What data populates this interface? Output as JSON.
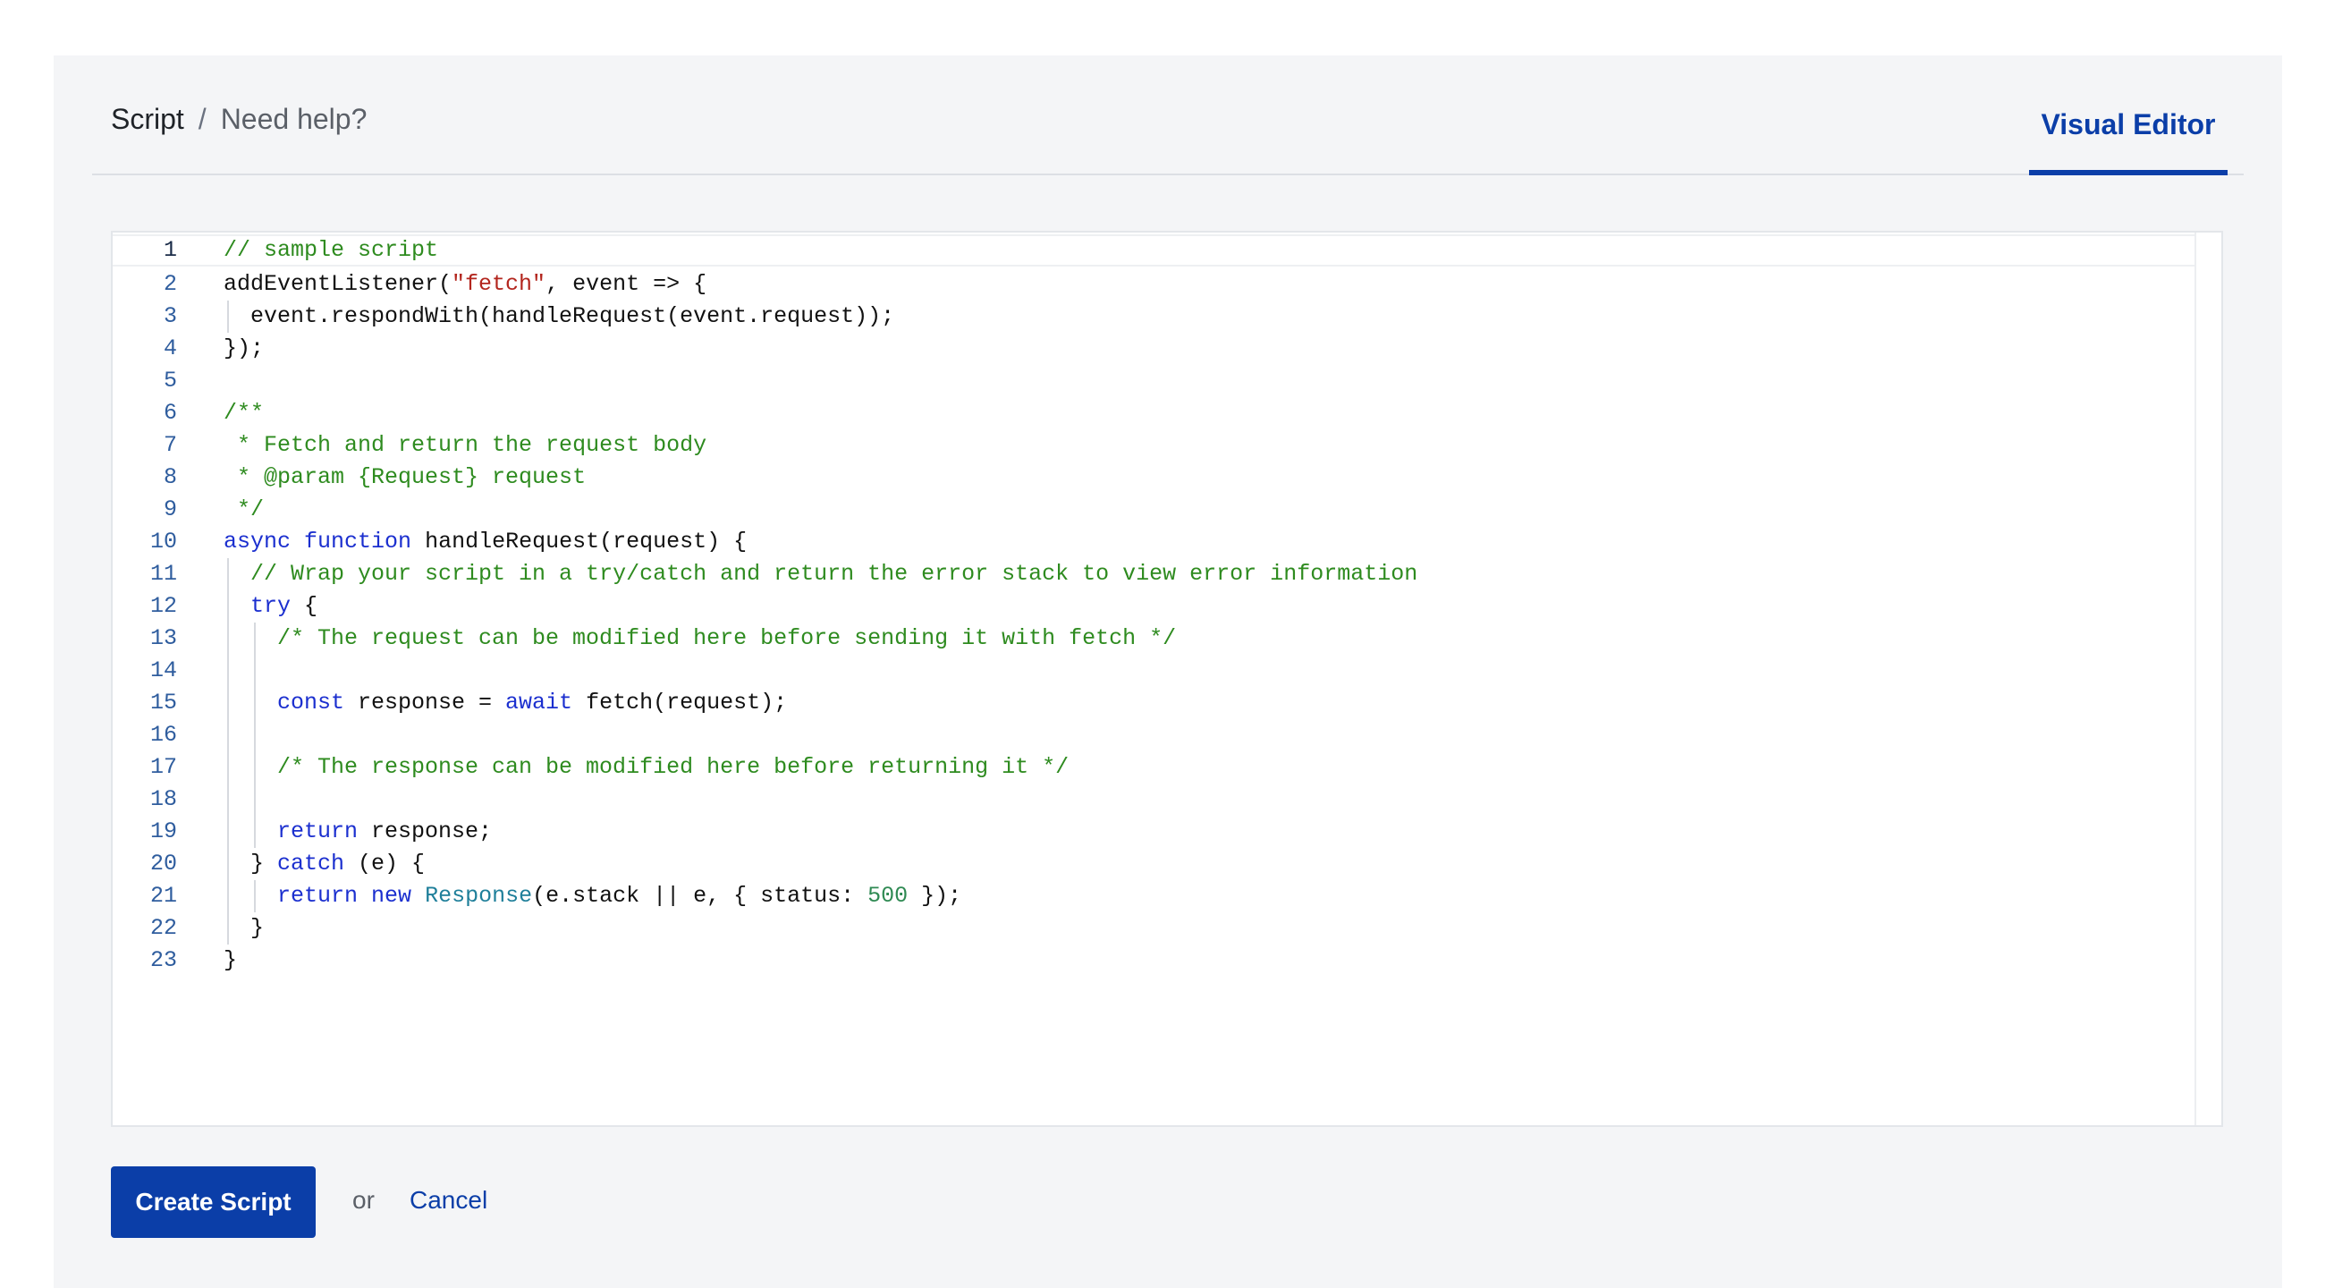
{
  "breadcrumb": {
    "current": "Script",
    "separator": "/",
    "help_link": "Need help?"
  },
  "tabs": {
    "visual_editor": "Visual Editor"
  },
  "editor": {
    "language": "javascript",
    "lines": [
      {
        "n": "1",
        "indent": 0,
        "tokens": [
          {
            "t": "// sample script",
            "c": "comment"
          }
        ]
      },
      {
        "n": "2",
        "indent": 0,
        "tokens": [
          {
            "t": "addEventListener(",
            "c": "plain"
          },
          {
            "t": "\"fetch\"",
            "c": "string"
          },
          {
            "t": ", event => {",
            "c": "plain"
          }
        ]
      },
      {
        "n": "3",
        "indent": 1,
        "tokens": [
          {
            "t": "event.respondWith(handleRequest(event.request));",
            "c": "plain"
          }
        ]
      },
      {
        "n": "4",
        "indent": 0,
        "tokens": [
          {
            "t": "});",
            "c": "plain"
          }
        ]
      },
      {
        "n": "5",
        "indent": 0,
        "tokens": []
      },
      {
        "n": "6",
        "indent": 0,
        "tokens": [
          {
            "t": "/**",
            "c": "comment"
          }
        ]
      },
      {
        "n": "7",
        "indent": 0,
        "tokens": [
          {
            "t": " * Fetch and return the request body",
            "c": "comment"
          }
        ]
      },
      {
        "n": "8",
        "indent": 0,
        "tokens": [
          {
            "t": " * @param {Request} request",
            "c": "comment"
          }
        ]
      },
      {
        "n": "9",
        "indent": 0,
        "tokens": [
          {
            "t": " */",
            "c": "comment"
          }
        ]
      },
      {
        "n": "10",
        "indent": 0,
        "tokens": [
          {
            "t": "async",
            "c": "keyword"
          },
          {
            "t": " ",
            "c": "plain"
          },
          {
            "t": "function",
            "c": "keyword"
          },
          {
            "t": " handleRequest(request) {",
            "c": "plain"
          }
        ]
      },
      {
        "n": "11",
        "indent": 1,
        "tokens": [
          {
            "t": "// Wrap your script in a try/catch and return the error stack to view error information",
            "c": "comment"
          }
        ]
      },
      {
        "n": "12",
        "indent": 1,
        "tokens": [
          {
            "t": "try",
            "c": "keyword"
          },
          {
            "t": " {",
            "c": "plain"
          }
        ]
      },
      {
        "n": "13",
        "indent": 2,
        "tokens": [
          {
            "t": "/* The request can be modified here before sending it with fetch */",
            "c": "comment"
          }
        ]
      },
      {
        "n": "14",
        "indent": 2,
        "tokens": []
      },
      {
        "n": "15",
        "indent": 2,
        "tokens": [
          {
            "t": "const",
            "c": "keyword"
          },
          {
            "t": " response = ",
            "c": "plain"
          },
          {
            "t": "await",
            "c": "keyword"
          },
          {
            "t": " fetch(request);",
            "c": "plain"
          }
        ]
      },
      {
        "n": "16",
        "indent": 2,
        "tokens": []
      },
      {
        "n": "17",
        "indent": 2,
        "tokens": [
          {
            "t": "/* The response can be modified here before returning it */",
            "c": "comment"
          }
        ]
      },
      {
        "n": "18",
        "indent": 2,
        "tokens": []
      },
      {
        "n": "19",
        "indent": 2,
        "tokens": [
          {
            "t": "return",
            "c": "keyword"
          },
          {
            "t": " response;",
            "c": "plain"
          }
        ]
      },
      {
        "n": "20",
        "indent": 1,
        "tokens": [
          {
            "t": "} ",
            "c": "plain"
          },
          {
            "t": "catch",
            "c": "keyword"
          },
          {
            "t": " (e) {",
            "c": "plain"
          }
        ]
      },
      {
        "n": "21",
        "indent": 2,
        "tokens": [
          {
            "t": "return",
            "c": "keyword"
          },
          {
            "t": " ",
            "c": "plain"
          },
          {
            "t": "new",
            "c": "keyword"
          },
          {
            "t": " ",
            "c": "plain"
          },
          {
            "t": "Response",
            "c": "type"
          },
          {
            "t": "(e.stack || e, { status: ",
            "c": "plain"
          },
          {
            "t": "500",
            "c": "number"
          },
          {
            "t": " });",
            "c": "plain"
          }
        ]
      },
      {
        "n": "22",
        "indent": 1,
        "tokens": [
          {
            "t": "}",
            "c": "plain"
          }
        ]
      },
      {
        "n": "23",
        "indent": 0,
        "tokens": [
          {
            "t": "}",
            "c": "plain"
          }
        ]
      }
    ]
  },
  "actions": {
    "create_label": "Create Script",
    "or_text": "or",
    "cancel_label": "Cancel"
  },
  "colors": {
    "primary": "#0b3ea8",
    "panel_bg": "#f4f5f7",
    "comment": "#2e8b1f",
    "keyword": "#1b2fcf",
    "string": "#b3261e",
    "type": "#1f7f9a",
    "number": "#2f8a53"
  }
}
